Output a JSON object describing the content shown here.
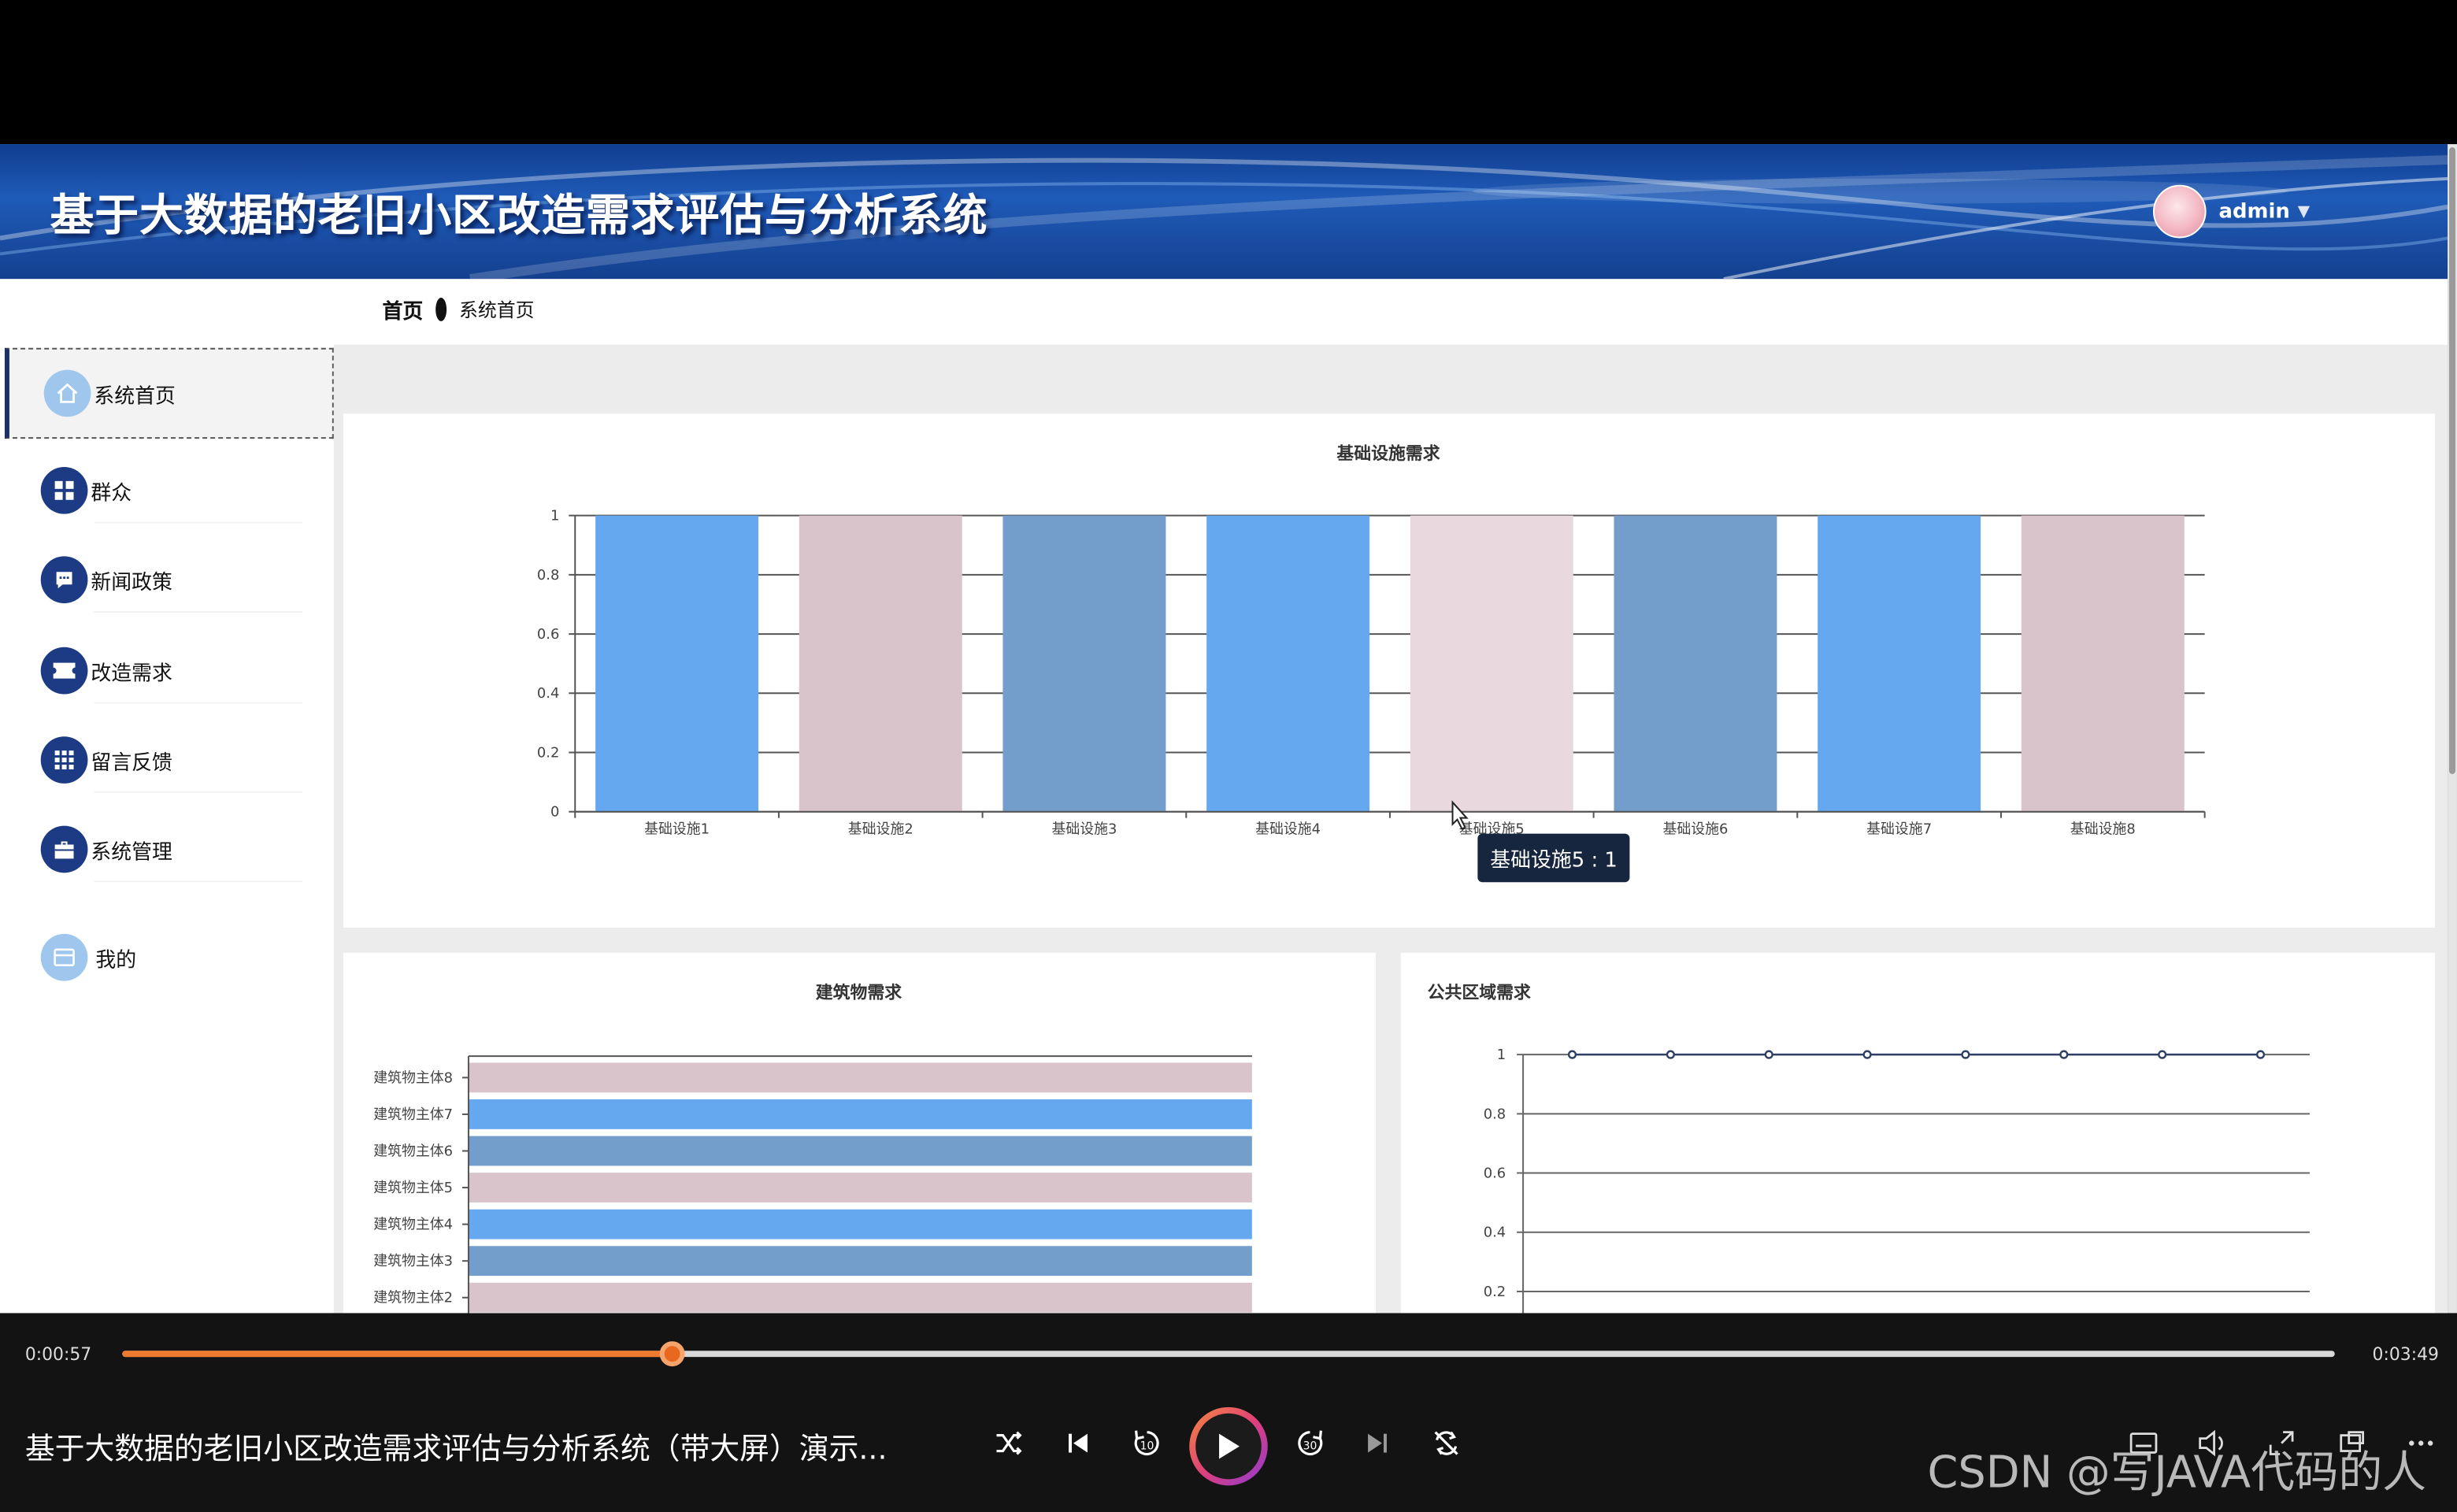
{
  "header": {
    "title": "基于大数据的老旧小区改造需求评估与分析系统",
    "username": "admin"
  },
  "breadcrumb": {
    "home": "首页",
    "current": "系统首页"
  },
  "sidebar": {
    "items": [
      {
        "label": "系统首页",
        "icon": "home-icon",
        "active": true
      },
      {
        "label": "群众",
        "icon": "grid-icon"
      },
      {
        "label": "新闻政策",
        "icon": "chat-icon"
      },
      {
        "label": "改造需求",
        "icon": "ticket-icon"
      },
      {
        "label": "留言反馈",
        "icon": "apps-icon"
      },
      {
        "label": "系统管理",
        "icon": "briefcase-icon"
      },
      {
        "label": "我的",
        "icon": "card-icon"
      }
    ]
  },
  "colors": {
    "header_blue": "#1f5bb8",
    "bar_blue": "#65a8ef",
    "bar_pink": "#d8c4ca",
    "bar_steel": "#739ecb",
    "bar_lightpink": "#e9d8dd",
    "progress_orange": "#ee7a2f"
  },
  "chart_data": [
    {
      "type": "bar",
      "title": "基础设施需求",
      "categories": [
        "基础设施1",
        "基础设施2",
        "基础设施3",
        "基础设施4",
        "基础设施5",
        "基础设施6",
        "基础设施7",
        "基础设施8"
      ],
      "values": [
        1,
        1,
        1,
        1,
        1,
        1,
        1,
        1
      ],
      "ylim": [
        0,
        1
      ],
      "yticks": [
        "0",
        "0.2",
        "0.4",
        "0.6",
        "0.8",
        "1"
      ],
      "colors": [
        "#65a8ef",
        "#d8c4ca",
        "#739ecb",
        "#65a8ef",
        "#e9d8dd",
        "#739ecb",
        "#65a8ef",
        "#d8c4ca"
      ],
      "grid": true,
      "tooltip": "基础设施5 : 1"
    },
    {
      "type": "bar",
      "orientation": "horizontal",
      "title": "建筑物需求",
      "categories": [
        "建筑物主体8",
        "建筑物主体7",
        "建筑物主体6",
        "建筑物主体5",
        "建筑物主体4",
        "建筑物主体3",
        "建筑物主体2"
      ],
      "values": [
        1,
        1,
        1,
        1,
        1,
        1,
        1
      ],
      "colors": [
        "#d8c4ca",
        "#65a8ef",
        "#739ecb",
        "#d8c4ca",
        "#65a8ef",
        "#739ecb",
        "#d8c4ca"
      ]
    },
    {
      "type": "line",
      "title": "公共区域需求",
      "values": [
        1,
        1,
        1,
        1,
        1,
        1,
        1,
        1
      ],
      "ylim": [
        0.2,
        1
      ],
      "yticks": [
        "1",
        "0.8",
        "0.6",
        "0.4",
        "0.2"
      ],
      "grid": true
    }
  ],
  "player": {
    "current_time": "0:00:57",
    "total_time": "0:03:49",
    "progress": 0.2489,
    "title": "基于大数据的老旧小区改造需求评估与分析系统（带大屏）演示...",
    "watermark": "CSDN @写JAVA代码的人"
  }
}
